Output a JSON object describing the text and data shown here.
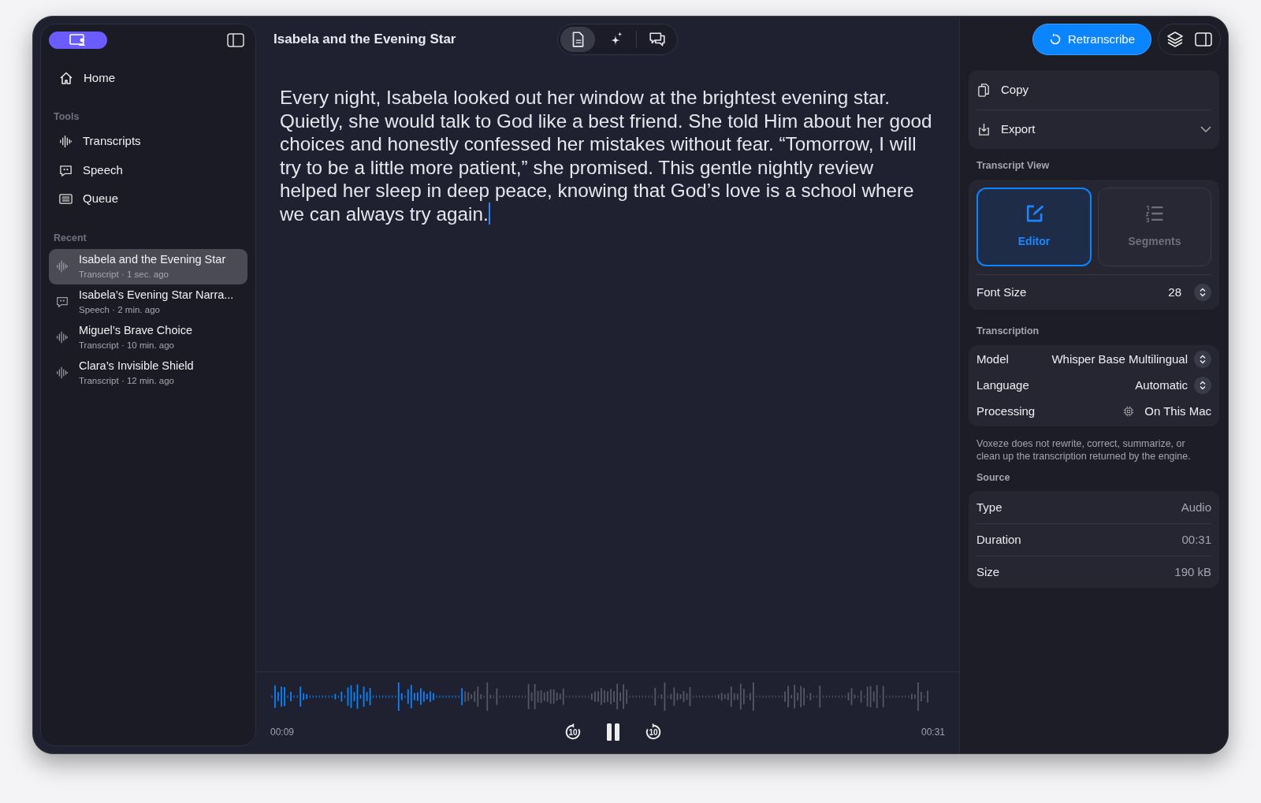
{
  "sidebar": {
    "home": {
      "label": "Home"
    },
    "tools_heading": "Tools",
    "tools": [
      {
        "label": "Transcripts",
        "kind": "waveform"
      },
      {
        "label": "Speech",
        "kind": "speech"
      },
      {
        "label": "Queue",
        "kind": "queue"
      }
    ],
    "recent_heading": "Recent",
    "recent": [
      {
        "title": "Isabela and the Evening Star",
        "subtitle": "Transcript · 1 sec. ago",
        "kind": "waveform",
        "selected": true
      },
      {
        "title": "Isabela’s Evening Star Narra...",
        "subtitle": "Speech · 2 min. ago",
        "kind": "speech",
        "selected": false
      },
      {
        "title": "Miguel’s Brave Choice",
        "subtitle": "Transcript · 10 min. ago",
        "kind": "waveform",
        "selected": false
      },
      {
        "title": "Clara’s Invisible Shield",
        "subtitle": "Transcript · 12 min. ago",
        "kind": "waveform",
        "selected": false
      }
    ]
  },
  "editor": {
    "title": "Isabela and the Evening Star",
    "modes": [
      {
        "kind": "document",
        "selected": true
      },
      {
        "kind": "sparkle",
        "selected": false
      },
      {
        "kind": "chat",
        "selected": false
      }
    ],
    "text": "Every night, Isabela looked out her window at the brightest evening star. Quietly, she would talk to God like a best friend. She told Him about her good choices and honestly confessed her mistakes without fear. “Tomorrow, I will try to be a little more patient,” she promised. This gentle nightly review helped her sleep in deep peace, knowing that God’s love is a school where we can always try again.",
    "playback": {
      "level": 0.29,
      "elapsed": "00:09",
      "total": "00:31",
      "skip_back": "10",
      "skip_forward": "10",
      "playing": true
    }
  },
  "inspector": {
    "retranscribe": "Retranscribe",
    "actions": [
      {
        "label": "Copy",
        "kind": "copy"
      },
      {
        "label": "Export",
        "kind": "export"
      }
    ],
    "view_heading": "Transcript View",
    "views": [
      {
        "label": "Editor",
        "kind": "editor",
        "selected": true
      },
      {
        "label": "Segments",
        "kind": "segments",
        "selected": false
      }
    ],
    "font_size": {
      "label": "Font Size",
      "value": "28"
    },
    "transcription_heading": "Transcription",
    "transcription": [
      {
        "label": "Model",
        "value": "Whisper Base Multilingual",
        "kind": "stepper"
      },
      {
        "label": "Language",
        "value": "Automatic",
        "kind": "stepper"
      },
      {
        "label": "Processing",
        "value": "On This Mac",
        "kind": "chip"
      }
    ],
    "note": "Voxeze does not rewrite, correct, summarize, or clean up the transcription returned by the engine.",
    "source_heading": "Source",
    "source": [
      {
        "label": "Type",
        "value": "Audio"
      },
      {
        "label": "Duration",
        "value": "00:31"
      },
      {
        "label": "Size",
        "value": "190 kB"
      }
    ]
  }
}
